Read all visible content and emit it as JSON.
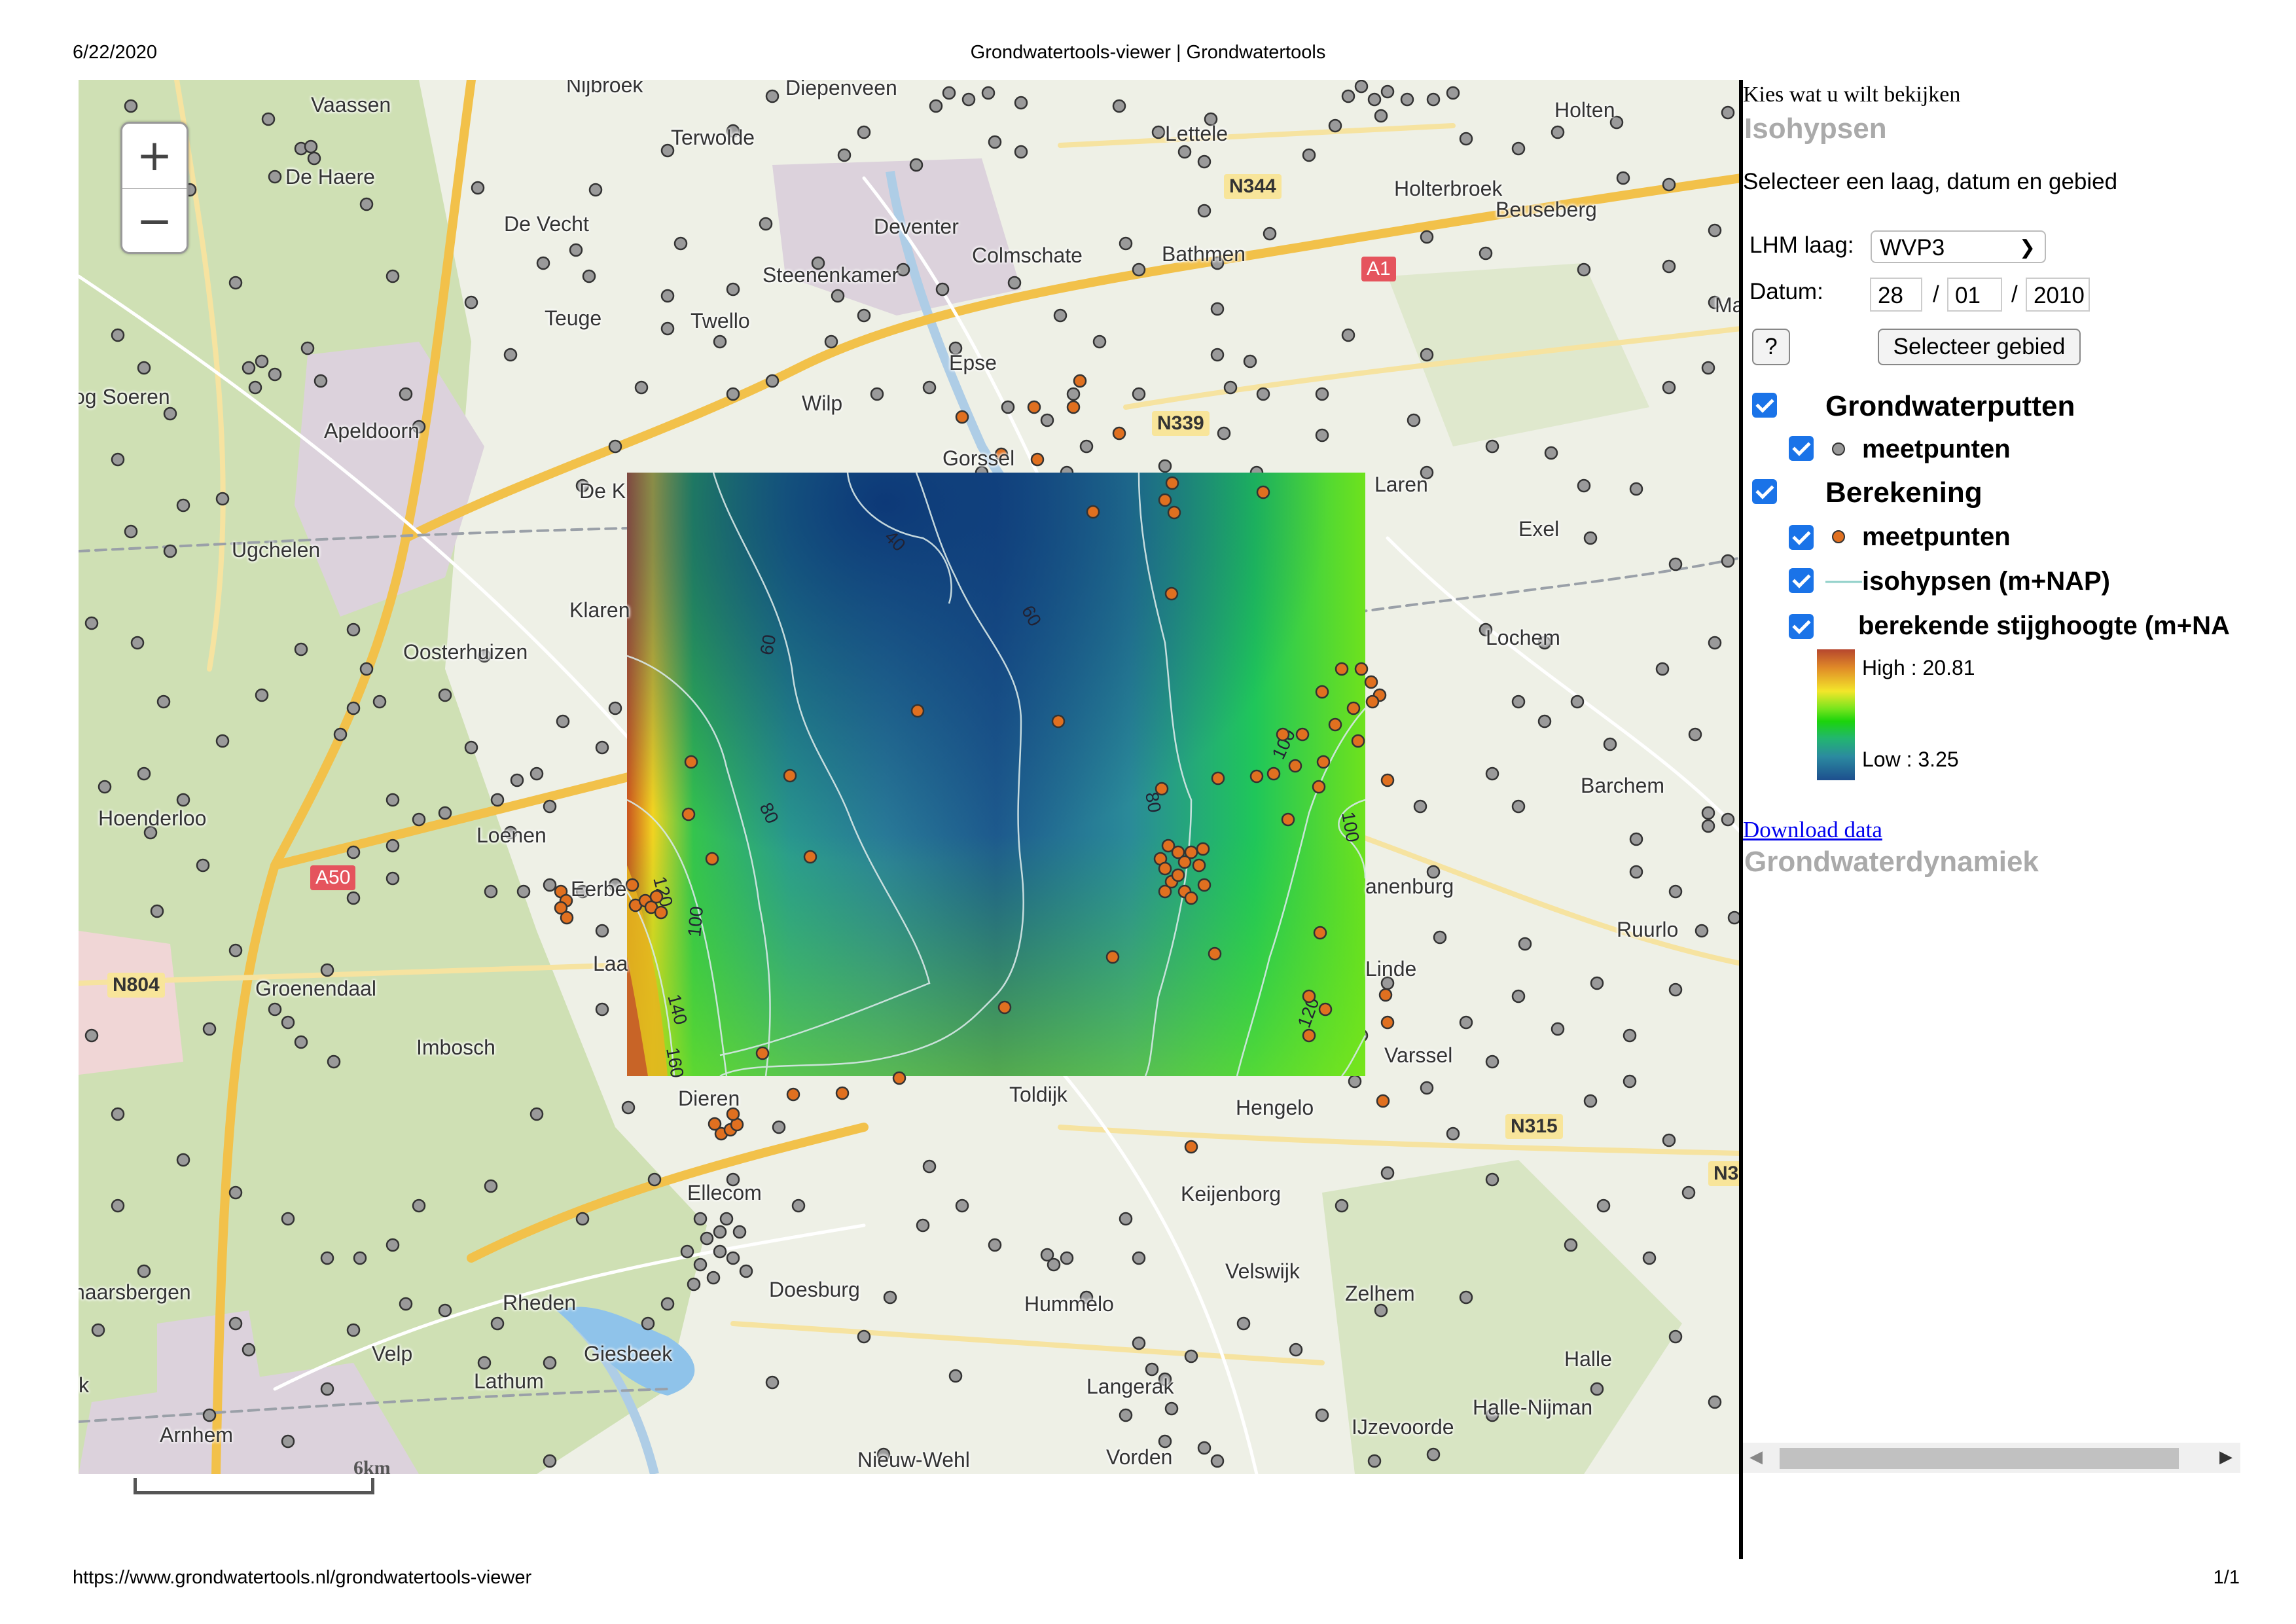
{
  "print": {
    "date": "6/22/2020",
    "title": "Grondwatertools-viewer | Grondwatertools",
    "url": "https://www.grondwatertools.nl/grondwatertools-viewer",
    "page": "1/1"
  },
  "map": {
    "zoom_in": "+",
    "zoom_out": "−",
    "scale": "6km",
    "places": [
      "Nijbroek",
      "Diepenveen",
      "Vaassen",
      "Terwolde",
      "Lettele",
      "Holten",
      "De Haere",
      "Deventer",
      "Holterbroek",
      "Beuseberg",
      "De Vecht",
      "Colmschate",
      "Bathmen",
      "Steenenkamer",
      "Teuge",
      "Twello",
      "Epse",
      "og Soeren",
      "Wilp",
      "Apeldoorn",
      "Gorssel",
      "Laren",
      "De K",
      "Ugchelen",
      "Exel",
      "Klaren",
      "Lochem",
      "Oosterhuizen",
      "Barchem",
      "Hoenderloo",
      "Loenen",
      "Eerbe",
      "anenburg",
      "Ruurlo",
      "Laa",
      "Linde",
      "Groenendaal",
      "Imbosch",
      "Varssel",
      "Dieren",
      "Toldijk",
      "Hengelo",
      "Ellecom",
      "Keijenborg",
      "haarsbergen",
      "Rheden",
      "Doesburg",
      "Vorden",
      "Velswijk",
      "Hummelo",
      "Zelhem",
      "Velp",
      "Giesbeek",
      "Halle",
      "Lathum",
      "Arnhem",
      "Langerak",
      "Halle-Nijman",
      "IJzevoorde",
      "Nieuw-Wehl",
      "Ma",
      "k"
    ],
    "roads": [
      "N344",
      "A1",
      "N339",
      "A50",
      "N804",
      "N315",
      "N3"
    ],
    "colors": {
      "low": "#1d4f8e",
      "mid": "#2b8aa0",
      "green": "#1bd40c",
      "high": "#b6462e",
      "dot_grey": "#999999",
      "dot_orange": "#e07020"
    }
  },
  "raster": {
    "contours": [
      "40",
      "60",
      "60",
      "80",
      "80",
      "100",
      "100",
      "120",
      "100",
      "120",
      "140",
      "160"
    ]
  },
  "panel": {
    "heading": "Kies wat u wilt bekijken",
    "tab_isohypsen": "Isohypsen",
    "instruction": "Selecteer een laag, datum en gebied",
    "lhm_label": "LHM laag:",
    "lhm_value": "WVP3",
    "date_label": "Datum:",
    "day": "28",
    "month": "01",
    "year": "2010",
    "slash": "/",
    "help": "?",
    "select_area": "Selecteer gebied",
    "group1": "Grondwaterputten",
    "group1_item": "meetpunten",
    "group2": "Berekening",
    "group2_items": [
      "meetpunten",
      "isohypsen (m+NAP)",
      "berekende stijghoogte (m+NA"
    ],
    "legend_high": "High : 20.81",
    "legend_low": "Low : 3.25",
    "download": "Download data",
    "tab_dynamiek": "Grondwaterdynamiek",
    "scroll_left": "◀",
    "scroll_right": "▶"
  }
}
